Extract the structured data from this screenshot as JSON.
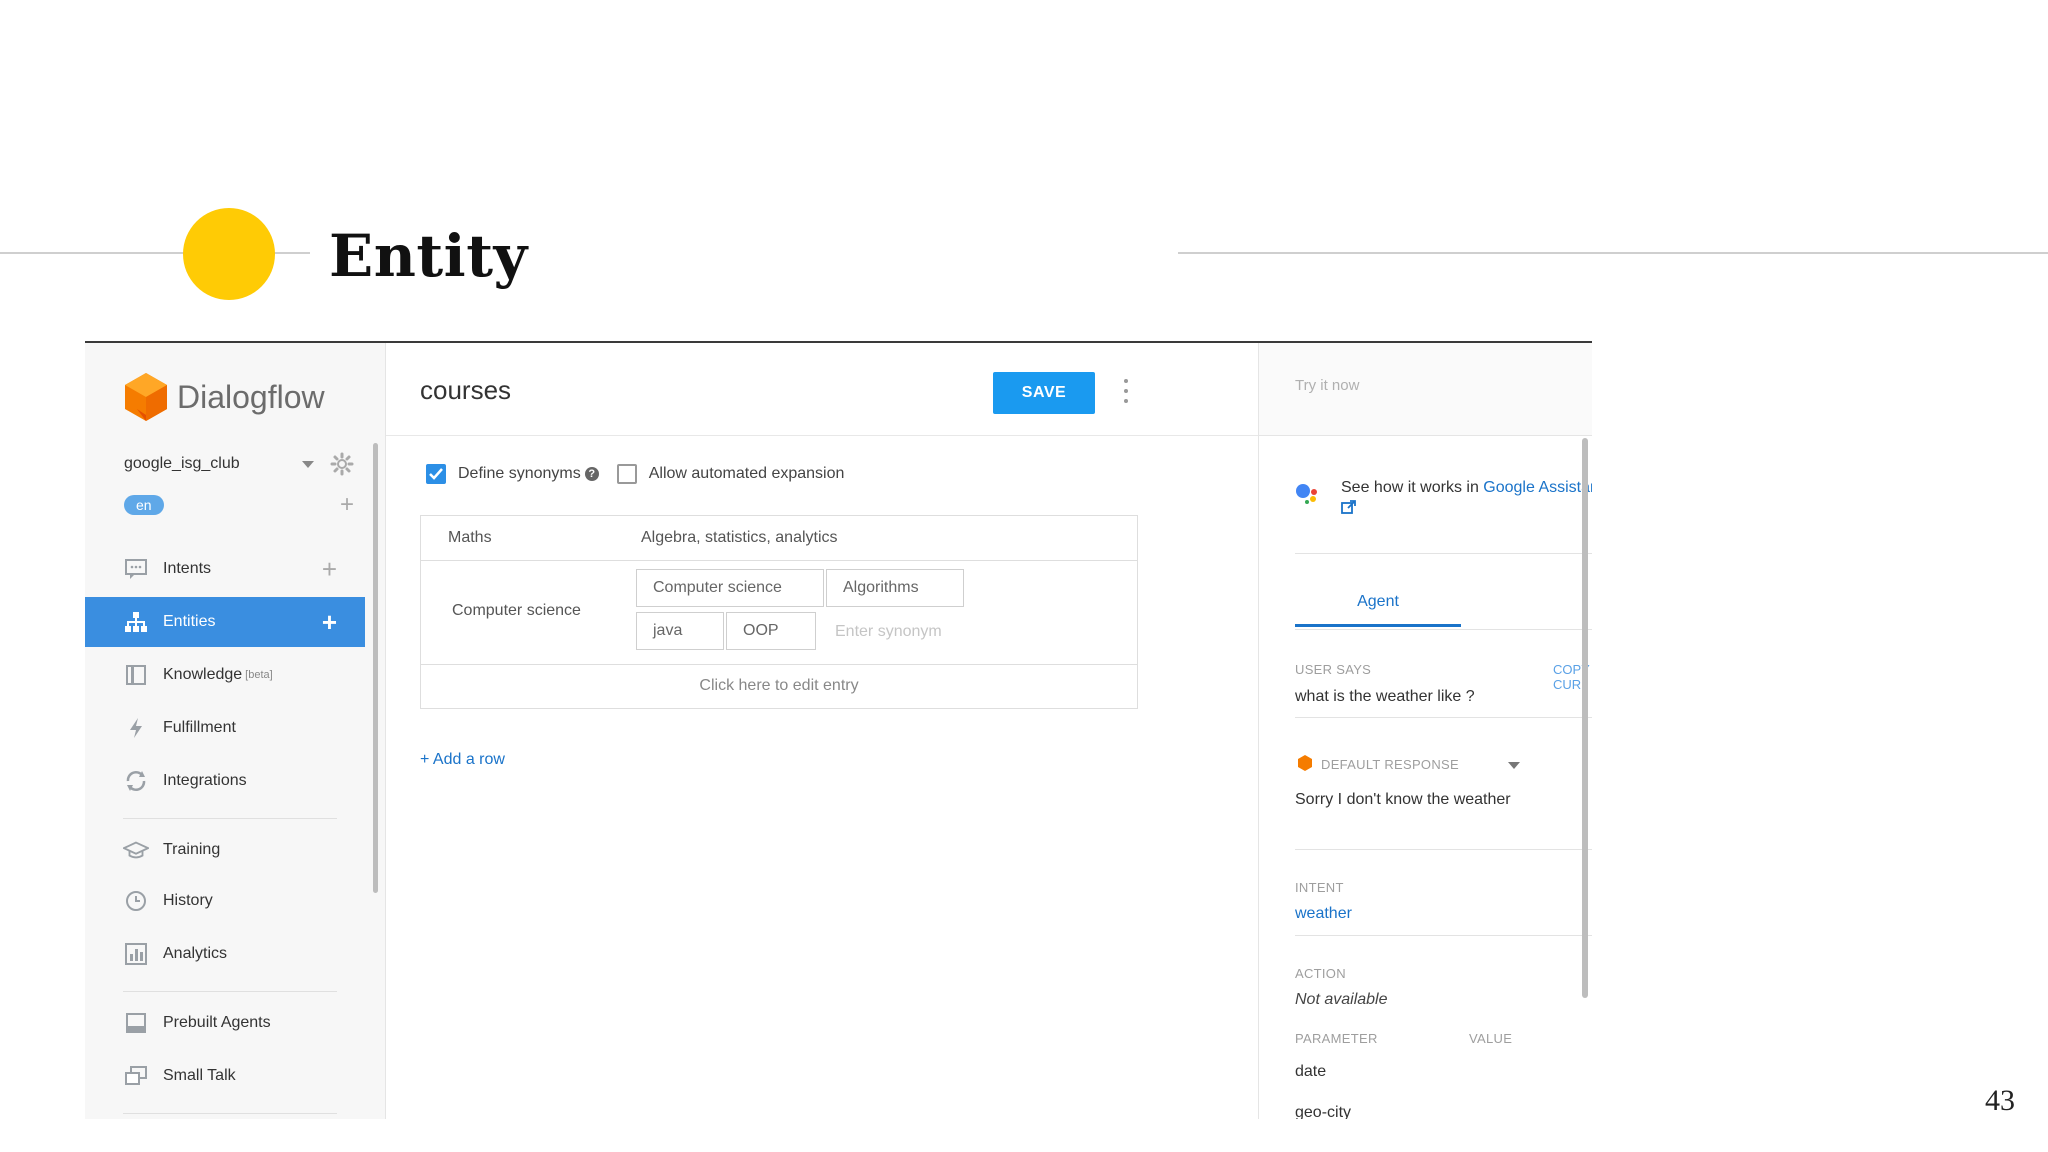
{
  "slide": {
    "title": "Entity",
    "page_number": "43"
  },
  "colors": {
    "accent_yellow": "#ffcb05",
    "active_nav": "#3a8ee0",
    "save_button": "#1a9af0",
    "link": "#1a73c9"
  },
  "sidebar": {
    "brand": "Dialogflow",
    "agent_name": "google_isg_club",
    "language": "en",
    "items": [
      {
        "label": "Intents",
        "icon": "chat-icon"
      },
      {
        "label": "Entities",
        "icon": "hierarchy-icon"
      },
      {
        "label": "Knowledge",
        "badge": "[beta]",
        "icon": "book-icon"
      },
      {
        "label": "Fulfillment",
        "icon": "bolt-icon"
      },
      {
        "label": "Integrations",
        "icon": "sync-icon"
      },
      {
        "label": "Training",
        "icon": "graduation-cap-icon"
      },
      {
        "label": "History",
        "icon": "clock-icon"
      },
      {
        "label": "Analytics",
        "icon": "bar-chart-icon"
      },
      {
        "label": "Prebuilt Agents",
        "icon": "template-icon"
      },
      {
        "label": "Small Talk",
        "icon": "speech-bubbles-icon"
      }
    ]
  },
  "main": {
    "entity_name": "courses",
    "save_label": "SAVE",
    "define_synonyms_label": "Define synonyms",
    "allow_expansion_label": "Allow automated expansion",
    "rows": [
      {
        "reference": "Maths",
        "synonyms_text": "Algebra, statistics, analytics"
      },
      {
        "reference": "Computer science",
        "synonyms": [
          "Computer science",
          "Algorithms",
          "java",
          "OOP"
        ],
        "placeholder": "Enter synonym"
      }
    ],
    "edit_entry_label": "Click here to edit entry",
    "add_row_label": "+ Add a row"
  },
  "test_panel": {
    "try_placeholder": "Try it now",
    "ga_text": "See how it works in ",
    "ga_link": "Google Assistant.",
    "tab_agent": "Agent",
    "user_says_label": "USER SAYS",
    "copy_curl_label": "COPY CURL",
    "user_says_value": "what is the weather like ?",
    "default_response_label": "DEFAULT RESPONSE",
    "default_response_value": "Sorry I don't know the weather",
    "intent_label": "INTENT",
    "intent_value": "weather",
    "action_label": "ACTION",
    "action_value": "Not available",
    "parameter_label": "PARAMETER",
    "value_label": "VALUE",
    "parameters": [
      "date",
      "geo-city"
    ]
  }
}
